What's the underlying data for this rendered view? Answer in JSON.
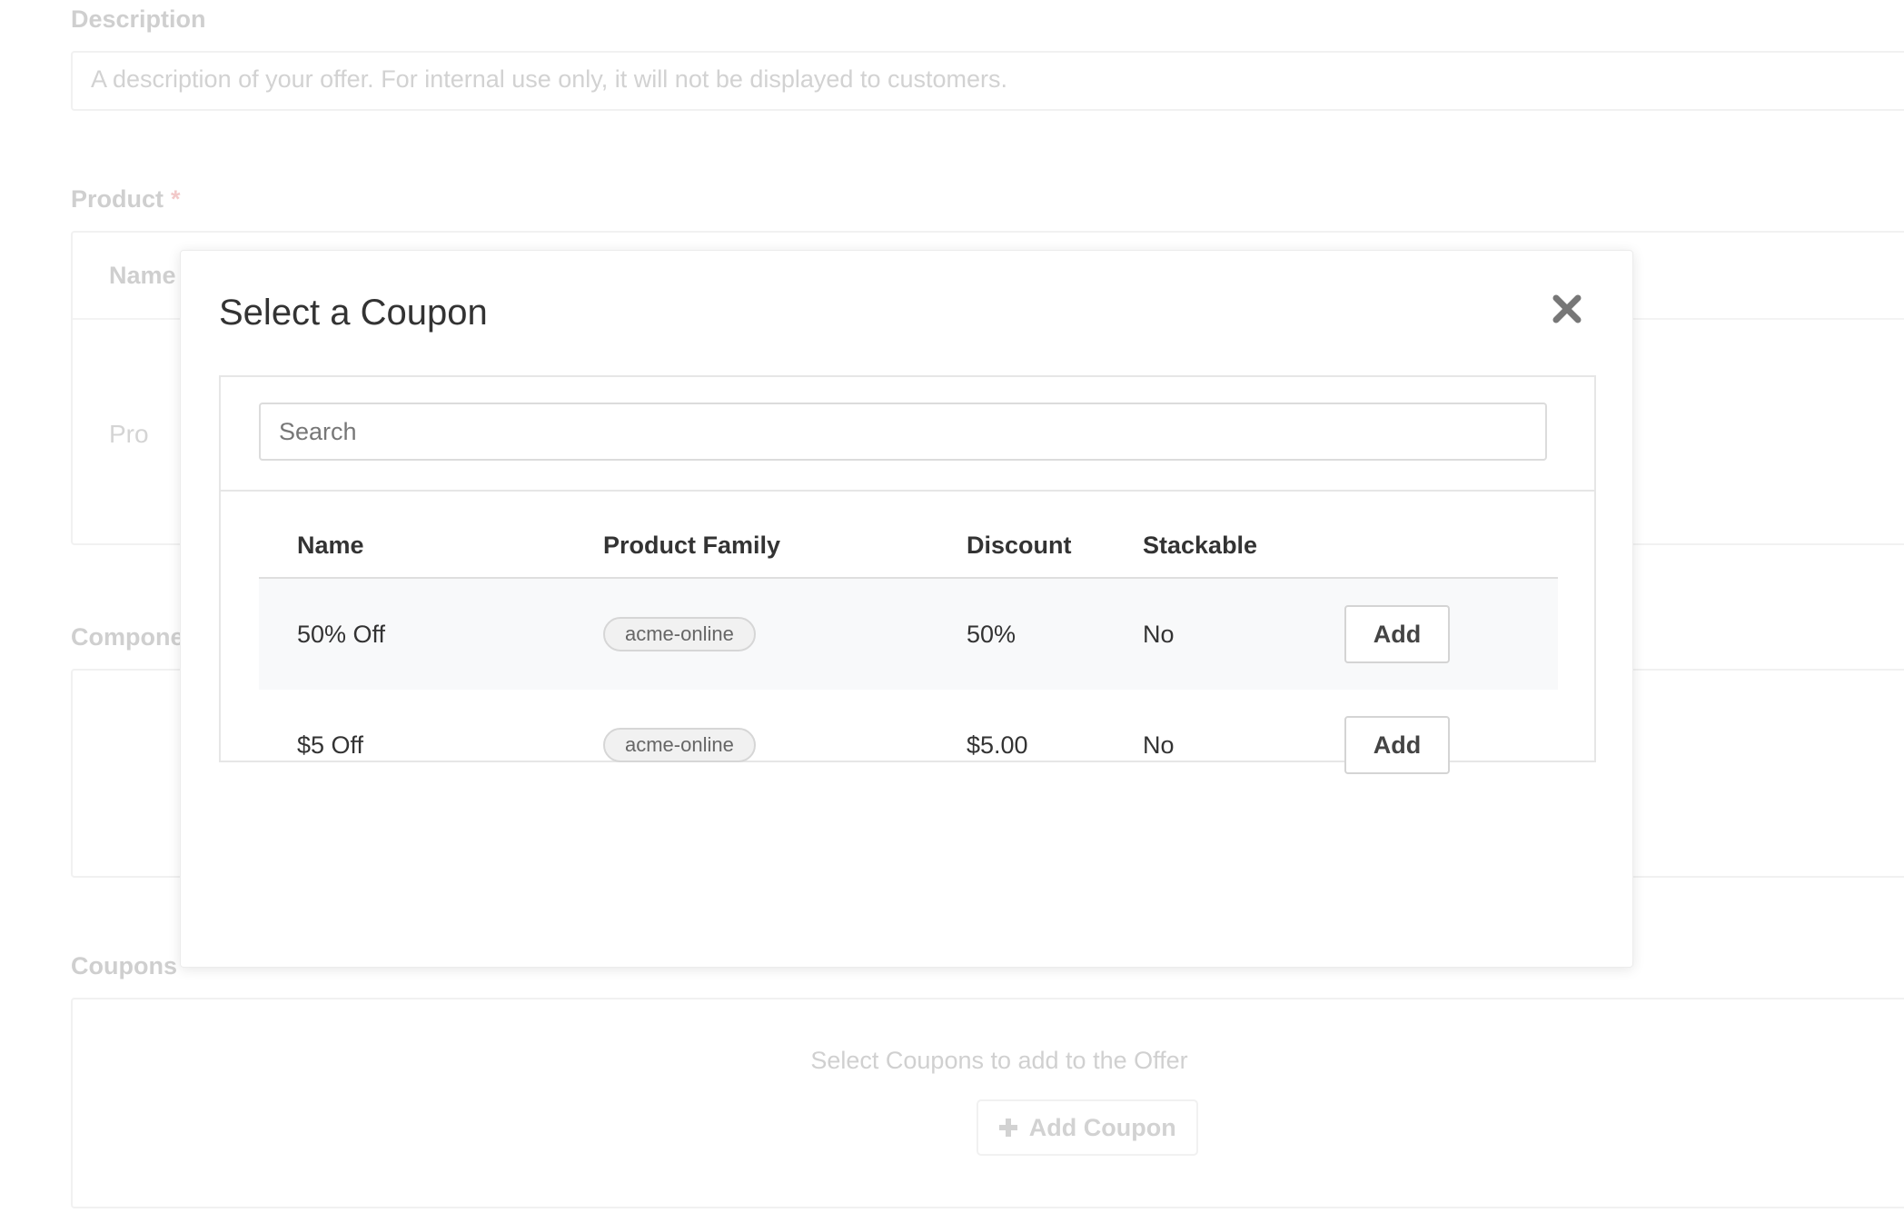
{
  "background": {
    "description_label": "Description",
    "description_placeholder": "A description of your offer. For internal use only, it will not be displayed to customers.",
    "product_label": "Product",
    "required_mark": "*",
    "product_table_header": "Name",
    "product_row_partial": "Pro",
    "components_label": "Compone",
    "coupons_label": "Coupons",
    "coupons_empty_text": "Select Coupons to add to the Offer",
    "add_coupon_label": "Add Coupon",
    "add_coupon_icon": "plus-icon"
  },
  "modal": {
    "title": "Select a Coupon",
    "close_icon": "close-icon",
    "search": {
      "placeholder": "Search",
      "value": ""
    },
    "columns": [
      "Name",
      "Product Family",
      "Discount",
      "Stackable"
    ],
    "rows": [
      {
        "name": "50% Off",
        "product_family": "acme-online",
        "discount": "50%",
        "stackable": "No",
        "action": "Add"
      },
      {
        "name": "$5 Off",
        "product_family": "acme-online",
        "discount": "$5.00",
        "stackable": "No",
        "action": "Add"
      }
    ]
  },
  "colors": {
    "close_icon": "#777777",
    "row_highlight": "#f8f9fa",
    "required": "#e8a0a0"
  }
}
